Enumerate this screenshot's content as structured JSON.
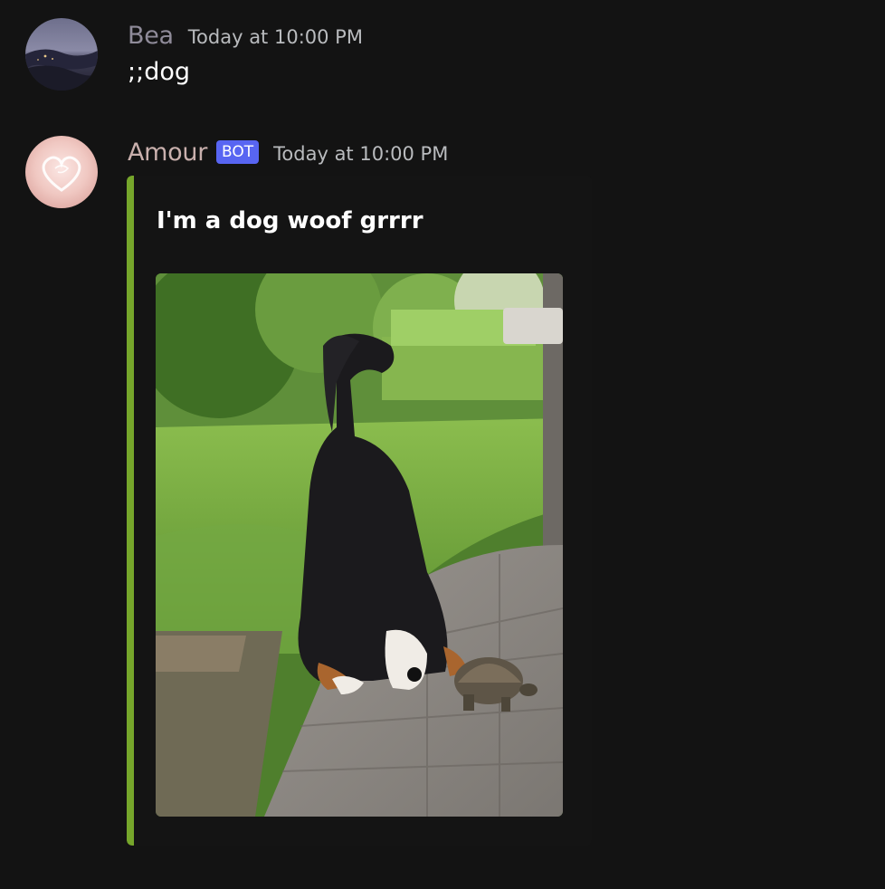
{
  "messages": [
    {
      "username": "Bea",
      "username_color": "#8f8b99",
      "timestamp": "Today at 10:00 PM",
      "content": ";;dog",
      "avatar": "night-landscape-avatar"
    },
    {
      "username": "Amour",
      "username_color": "#c9b0ad",
      "bot_tag": "BOT",
      "timestamp": "Today at 10:00 PM",
      "avatar": "pink-heart-avatar",
      "embed": {
        "accent_color": "#76a62b",
        "title": "I'm a dog woof grrrr",
        "image": "dog-and-tortoise-photo"
      }
    }
  ],
  "colors": {
    "background": "#131313",
    "bot_tag": "#5865f2",
    "timestamp": "#b9bbbe"
  }
}
